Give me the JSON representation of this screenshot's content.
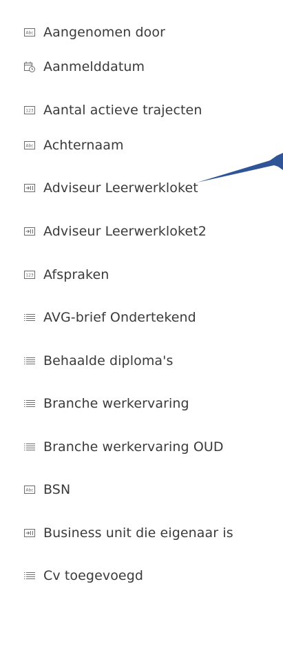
{
  "fields": [
    {
      "label": "Aangenomen door",
      "icon": "text-field-icon"
    },
    {
      "label": "Aanmelddatum",
      "icon": "datetime-field-icon"
    },
    {
      "label": "Aantal actieve trajecten",
      "icon": "number-field-icon"
    },
    {
      "label": "Achternaam",
      "icon": "text-field-icon"
    },
    {
      "label": "Adviseur Leerwerkloket",
      "icon": "lookup-field-icon"
    },
    {
      "label": "Adviseur Leerwerkloket2",
      "icon": "lookup-field-icon"
    },
    {
      "label": "Afspraken",
      "icon": "number-field-icon"
    },
    {
      "label": "AVG-brief Ondertekend",
      "icon": "option-set-field-icon"
    },
    {
      "label": "Behaalde diploma's",
      "icon": "option-set-field-icon"
    },
    {
      "label": "Branche werkervaring",
      "icon": "option-set-field-icon"
    },
    {
      "label": "Branche werkervaring OUD",
      "icon": "option-set-field-icon"
    },
    {
      "label": "BSN",
      "icon": "text-field-icon"
    },
    {
      "label": "Business unit die eigenaar is",
      "icon": "lookup-field-icon"
    },
    {
      "label": "Cv toegevoegd",
      "icon": "option-set-field-icon"
    }
  ],
  "colors": {
    "text": "#3a3a3a",
    "icon": "#6a6a6a",
    "arrow": "#2f5597"
  }
}
